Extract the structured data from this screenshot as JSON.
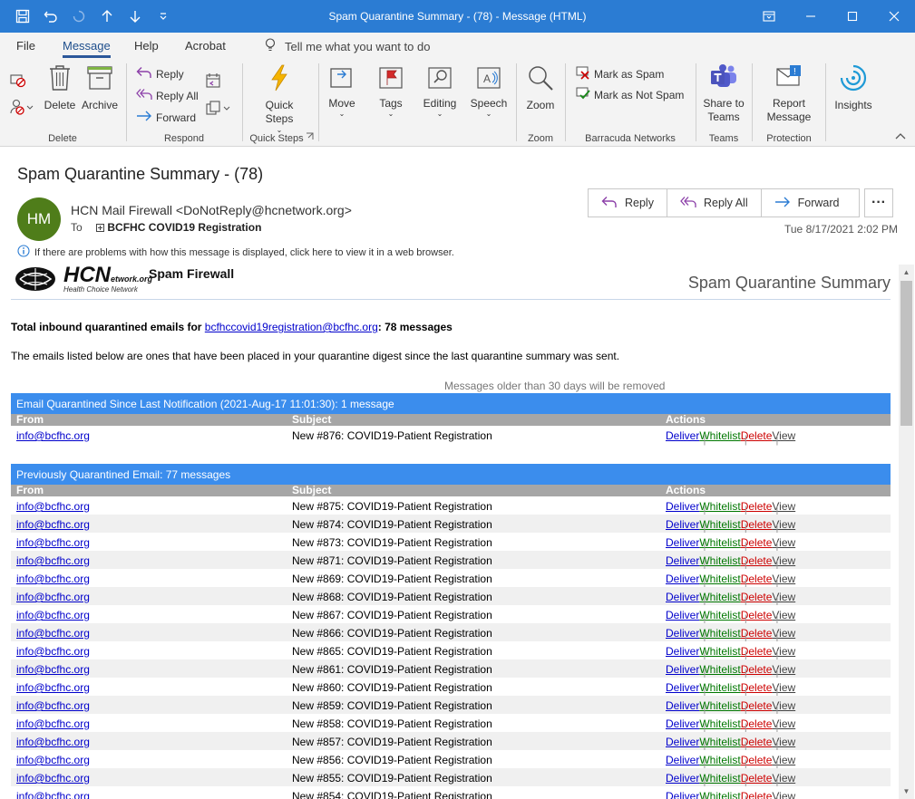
{
  "window": {
    "title": "Spam Quarantine Summary - (78)  -  Message (HTML)"
  },
  "menu": {
    "file": "File",
    "message": "Message",
    "help": "Help",
    "acrobat": "Acrobat",
    "tellme": "Tell me what you want to do"
  },
  "ribbon": {
    "delete_group": "Delete",
    "delete": "Delete",
    "archive": "Archive",
    "respond_group": "Respond",
    "reply": "Reply",
    "reply_all": "Reply All",
    "forward": "Forward",
    "quicksteps_group": "Quick Steps",
    "quick_steps": "Quick Steps",
    "move": "Move",
    "tags": "Tags",
    "editing": "Editing",
    "speech": "Speech",
    "zoom_group": "Zoom",
    "zoom": "Zoom",
    "barracuda_group": "Barracuda Networks",
    "mark_spam": "Mark as Spam",
    "mark_not_spam": "Mark as Not Spam",
    "teams_group": "Teams",
    "share_teams": "Share to Teams",
    "protection_group": "Protection",
    "report_message": "Report Message",
    "insights": "Insights"
  },
  "message": {
    "subject": "Spam Quarantine Summary - (78)",
    "avatar_initials": "HM",
    "sender": "HCN Mail Firewall <DoNotReply@hcnetwork.org>",
    "to_label": "To",
    "to_value": "BCFHC COVID19 Registration",
    "reply": "Reply",
    "reply_all": "Reply All",
    "forward": "Forward",
    "more": "···",
    "date": "Tue 8/17/2021 2:02 PM",
    "infobar": "If there are problems with how this message is displayed, click here to view it in a web browser."
  },
  "body": {
    "logo_text": "HCN",
    "logo_sub": "etwork.org",
    "logo_tagline": "Health Choice Network",
    "brand": "Spam Firewall",
    "summary_title": "Spam Quarantine Summary",
    "total_prefix": "Total inbound quarantined emails for ",
    "total_email": "bcfhccovid19registration@bcfhc.org",
    "total_suffix": ": 78 messages",
    "description": "The emails listed below are ones that have been placed in your quarantine digest since the last quarantine summary was sent.",
    "older_note": "Messages older than 30 days will be removed",
    "col_from": "From",
    "col_subject": "Subject",
    "col_actions": "Actions",
    "act_deliver": "Deliver",
    "act_whitelist": "Whitelist",
    "act_delete": "Delete",
    "act_view": "View",
    "section1": "Email Quarantined Since Last Notification (2021-Aug-17 11:01:30): 1 message",
    "section1_rows": [
      {
        "from": "info@bcfhc.org",
        "subject": "New #876: COVID19-Patient Registration"
      }
    ],
    "section2": "Previously Quarantined Email: 77 messages",
    "section2_rows": [
      {
        "from": "info@bcfhc.org",
        "subject": "New #875: COVID19-Patient Registration"
      },
      {
        "from": "info@bcfhc.org",
        "subject": "New #874: COVID19-Patient Registration"
      },
      {
        "from": "info@bcfhc.org",
        "subject": "New #873: COVID19-Patient Registration"
      },
      {
        "from": "info@bcfhc.org",
        "subject": "New #871: COVID19-Patient Registration"
      },
      {
        "from": "info@bcfhc.org",
        "subject": "New #869: COVID19-Patient Registration"
      },
      {
        "from": "info@bcfhc.org",
        "subject": "New #868: COVID19-Patient Registration"
      },
      {
        "from": "info@bcfhc.org",
        "subject": "New #867: COVID19-Patient Registration"
      },
      {
        "from": "info@bcfhc.org",
        "subject": "New #866: COVID19-Patient Registration"
      },
      {
        "from": "info@bcfhc.org",
        "subject": "New #865: COVID19-Patient Registration"
      },
      {
        "from": "info@bcfhc.org",
        "subject": "New #861: COVID19-Patient Registration"
      },
      {
        "from": "info@bcfhc.org",
        "subject": "New #860: COVID19-Patient Registration"
      },
      {
        "from": "info@bcfhc.org",
        "subject": "New #859: COVID19-Patient Registration"
      },
      {
        "from": "info@bcfhc.org",
        "subject": "New #858: COVID19-Patient Registration"
      },
      {
        "from": "info@bcfhc.org",
        "subject": "New #857: COVID19-Patient Registration"
      },
      {
        "from": "info@bcfhc.org",
        "subject": "New #856: COVID19-Patient Registration"
      },
      {
        "from": "info@bcfhc.org",
        "subject": "New #855: COVID19-Patient Registration"
      },
      {
        "from": "info@bcfhc.org",
        "subject": "New #854: COVID19-Patient Registration"
      }
    ]
  },
  "colors": {
    "titlebar": "#2b7cd3",
    "section_header": "#3b8ded",
    "column_header": "#a6a6a6",
    "deliver": "#0000cc",
    "whitelist": "#007700",
    "delete": "#cc0000"
  }
}
